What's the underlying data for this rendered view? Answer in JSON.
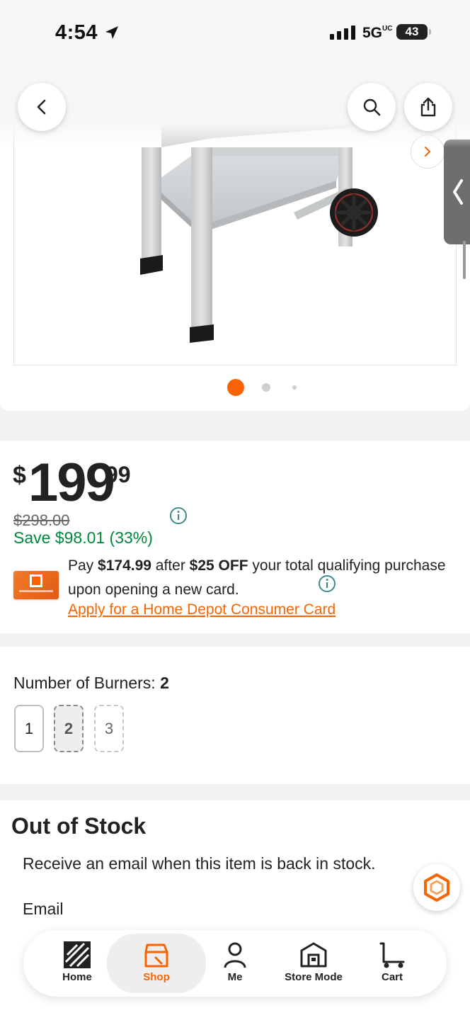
{
  "status_bar": {
    "time": "4:54",
    "network": "5G",
    "network_sup": "UC",
    "battery": "43"
  },
  "price": {
    "currency": "$",
    "dollars": "199",
    "cents": "99",
    "was": "$298.00",
    "save": "Save $98.01 (33%)"
  },
  "promo": {
    "pay_prefix": "Pay ",
    "pay_amount": "$174.99",
    "after": " after ",
    "off": "$25 OFF",
    "rest": " your total qualifying purchase upon opening a new card.",
    "apply_link": "Apply for a Home Depot Consumer Card"
  },
  "burners": {
    "label": "Number of Burners: ",
    "selected": "2",
    "options": [
      "1",
      "2",
      "3"
    ]
  },
  "stock": {
    "title": "Out of Stock",
    "subtitle": "Receive an email when this item is back in stock.",
    "email_label": "Email"
  },
  "carousel": {
    "total": 3,
    "active": 1
  },
  "nav": {
    "items": [
      {
        "label": "Home",
        "icon": "home-depot-logo-icon"
      },
      {
        "label": "Shop",
        "icon": "shop-icon"
      },
      {
        "label": "Me",
        "icon": "person-icon"
      },
      {
        "label": "Store Mode",
        "icon": "store-icon"
      },
      {
        "label": "Cart",
        "icon": "cart-icon"
      }
    ],
    "active": "Shop"
  },
  "colors": {
    "brand_orange": "#f96302",
    "save_green": "#00873c",
    "info_teal": "#3e8a8a"
  }
}
